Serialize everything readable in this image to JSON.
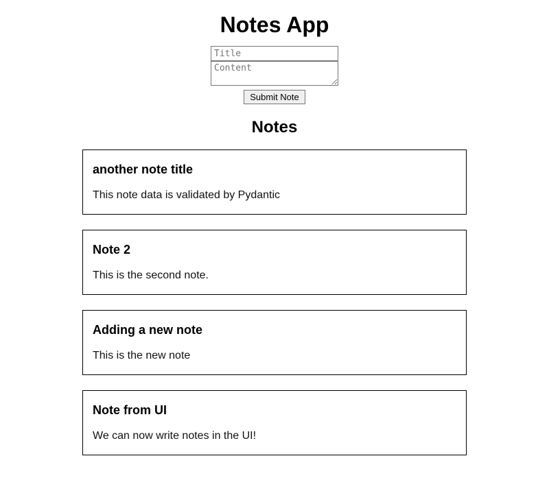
{
  "header": {
    "title": "Notes App"
  },
  "form": {
    "title_placeholder": "Title",
    "title_value": "",
    "content_placeholder": "Content",
    "content_value": "",
    "submit_label": "Submit Note"
  },
  "notes_section": {
    "heading": "Notes"
  },
  "notes": [
    {
      "title": "another note title",
      "content": "This note data is validated by Pydantic"
    },
    {
      "title": "Note 2",
      "content": "This is the second note."
    },
    {
      "title": "Adding a new note",
      "content": "This is the new note"
    },
    {
      "title": "Note from UI",
      "content": "We can now write notes in the UI!"
    }
  ]
}
